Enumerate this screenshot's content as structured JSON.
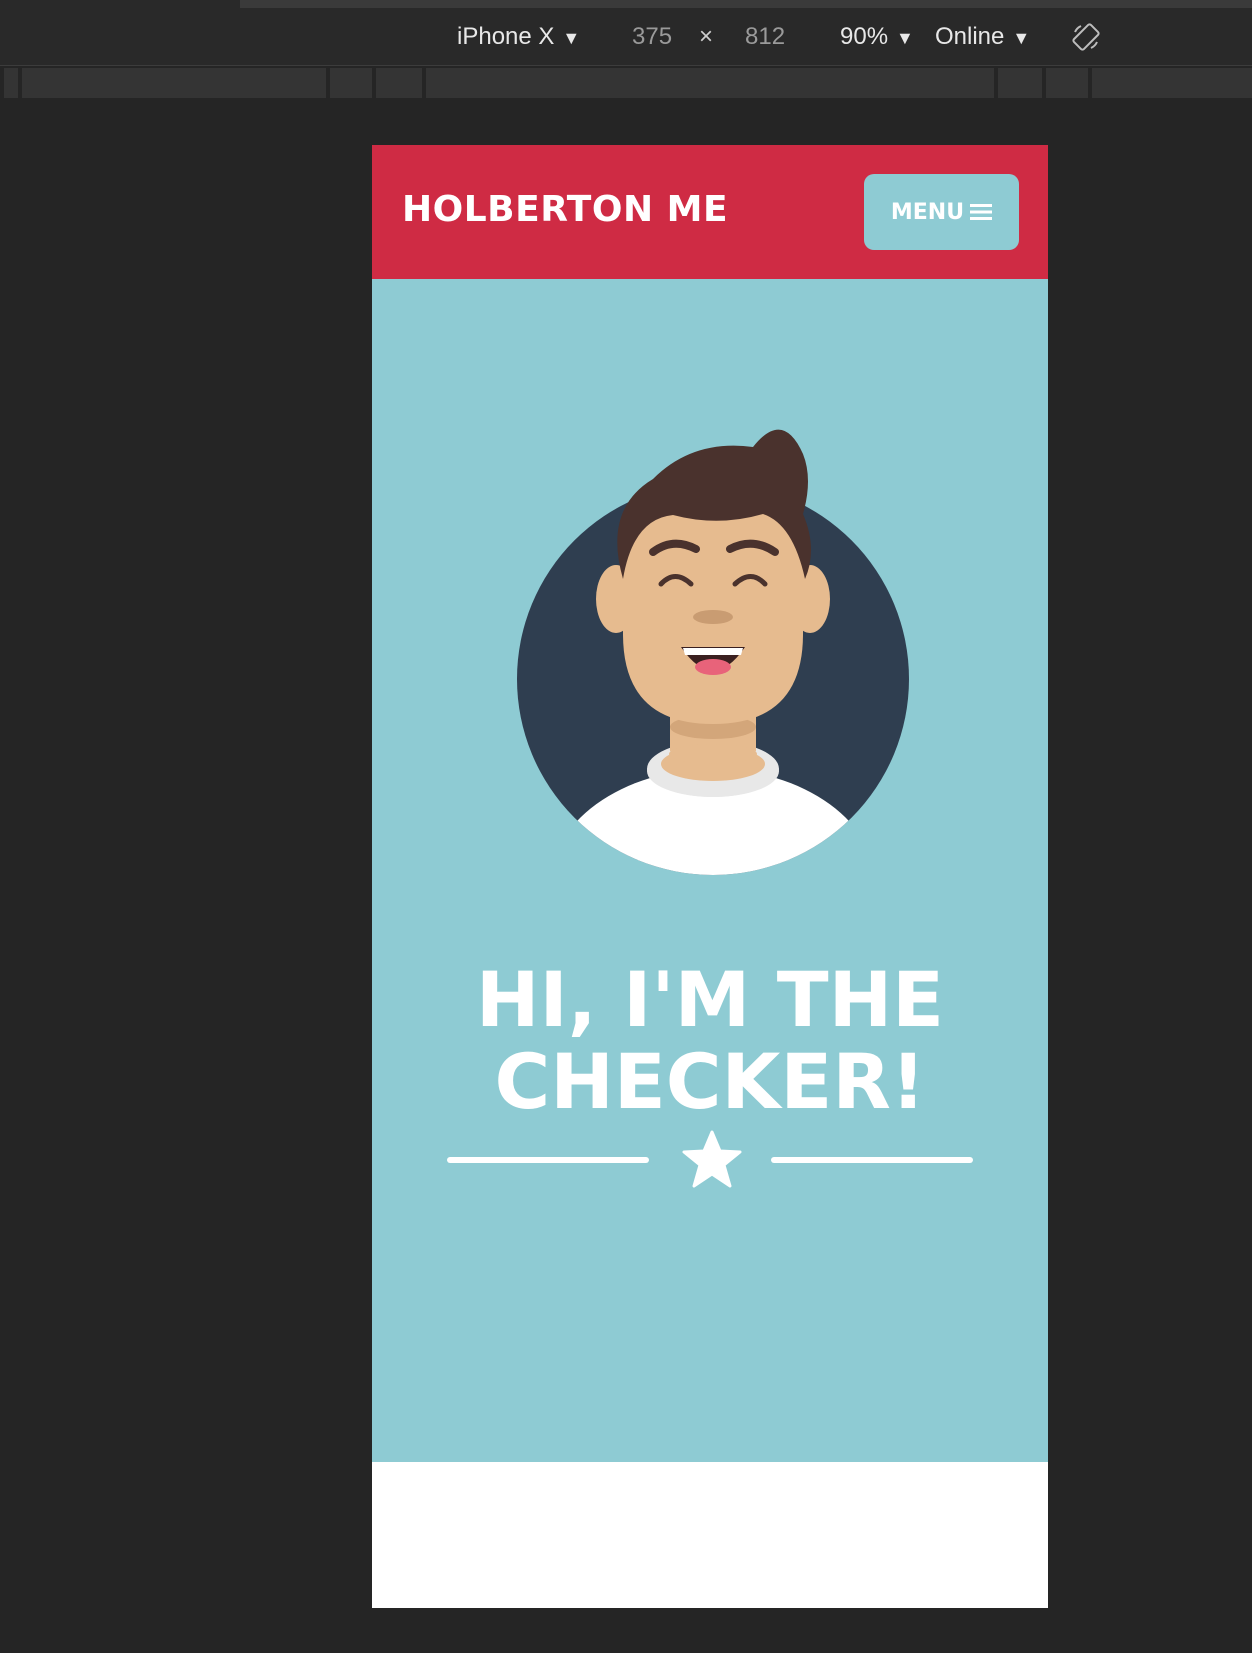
{
  "devtools": {
    "device": "iPhone X",
    "width": "375",
    "times": "×",
    "height": "812",
    "zoom": "90%",
    "network": "Online",
    "caret": "▼"
  },
  "site": {
    "brand": "HOLBERTON ME",
    "menu_label": "MENU",
    "headline_line1": "HI, I'M THE",
    "headline_line2": "CHECKER!"
  },
  "colors": {
    "header_bg": "#cf2b44",
    "hero_bg": "#8ecbd3",
    "menu_bg": "#8ecbd3",
    "avatar_circle": "#2f3e50",
    "hair": "#4a322d",
    "skin": "#e6bb8f"
  },
  "icons": {
    "menu": "hamburger-icon",
    "rotate": "rotate-device-icon",
    "divider": "star-icon"
  }
}
